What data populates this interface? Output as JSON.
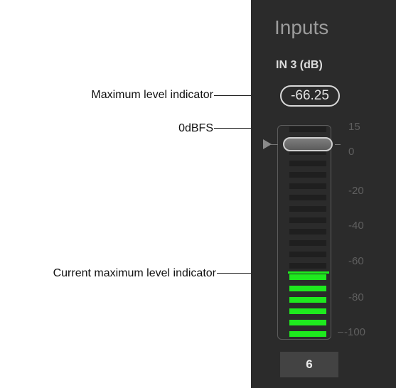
{
  "annotations": {
    "maximum_level": "Maximum level indicator",
    "zero_dbfs": "0dBFS",
    "current_maximum": "Current maximum level indicator"
  },
  "panel": {
    "title": "Inputs",
    "channel_label": "IN 3 (dB)",
    "max_level_value": "-66.25",
    "scale_ticks": [
      "15",
      "0",
      "-20",
      "-40",
      "-60",
      "-80",
      "-100"
    ],
    "channel_number": "6"
  },
  "meter": {
    "lit_segments": 6,
    "total_segments": 19,
    "fader_level_db": 0,
    "lit_color": "#1eea1e",
    "unlit_color": "#1f1f1f"
  }
}
